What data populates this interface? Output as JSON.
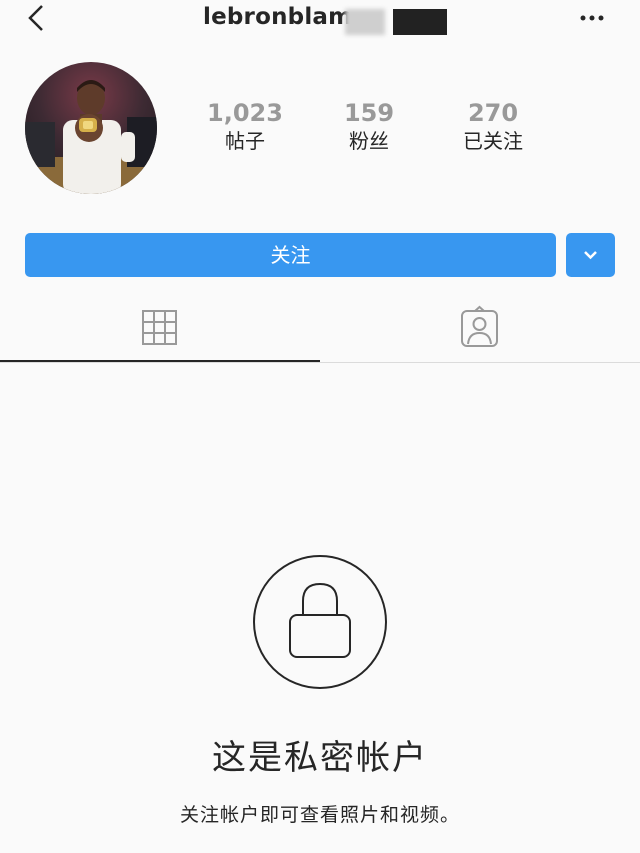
{
  "header": {
    "username": "lebronblam",
    "back_icon": "chevron-left-icon",
    "more_icon": "more-horizontal-icon"
  },
  "profile": {
    "avatar": "profile-photo",
    "stats": [
      {
        "value": "1,023",
        "label": "帖子"
      },
      {
        "value": "159",
        "label": "粉丝"
      },
      {
        "value": "270",
        "label": "已关注"
      }
    ]
  },
  "actions": {
    "follow_label": "关注",
    "dropdown_icon": "chevron-down-icon",
    "accent_color": "#3897f0"
  },
  "tabs": [
    {
      "icon": "grid-icon",
      "active": true
    },
    {
      "icon": "tagged-icon",
      "active": false
    }
  ],
  "private": {
    "icon": "lock-icon",
    "title": "这是私密帐户",
    "subtitle": "关注帐户即可查看照片和视频。"
  }
}
